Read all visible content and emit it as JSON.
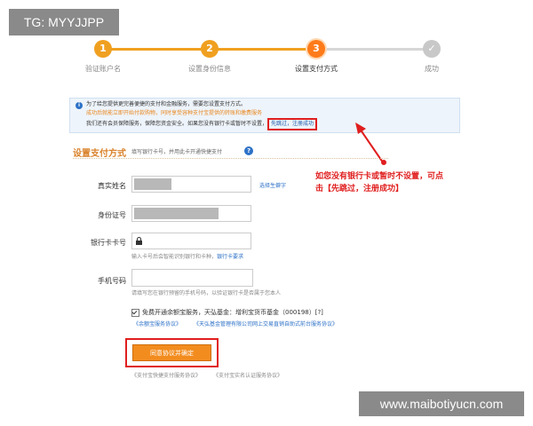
{
  "watermarks": {
    "top_left": "TG: MYYJJPP",
    "bottom_right": "www.maibotiyucn.com"
  },
  "steps": [
    {
      "number": "1",
      "label": "验证账户名",
      "state": "done"
    },
    {
      "number": "2",
      "label": "设置身份信息",
      "state": "done"
    },
    {
      "number": "3",
      "label": "设置支付方式",
      "state": "current"
    },
    {
      "number": "✓",
      "label": "成功",
      "state": "todo"
    }
  ],
  "notice": {
    "line1": "为了给您提供更完善便捷的支付和金融服务，需要您设置支付方式。",
    "line2": "成功后就能立即开始付款购物，同时享受容种支付宝提供的转账和缴费服务",
    "line3": "我们还有会员保障服务，保障您资金安全。如果您没有银行卡或暂时不设置，",
    "skip_link": "先跳过，注册成功"
  },
  "section": {
    "title": "设置支付方式",
    "hint": "填写银行卡号，并用此卡开通快捷支付"
  },
  "form": {
    "name_label": "真实姓名",
    "name_link": "选择生僻字",
    "id_label": "身份证号",
    "card_label": "银行卡卡号",
    "card_hint": "输入卡号后会智能识别银行和卡种，",
    "card_link": "银行卡要求",
    "phone_label": "手机号码",
    "phone_hint": "请填写您在银行预留的手机号码，以验证银行卡是否属于您本人"
  },
  "agreement": {
    "text": "免费开通余额宝服务，天弘基金：增利宝货币基金（000198）[?]",
    "link1": "《余额宝服务协议》",
    "link2": "《天弘基金管理有限公司网上交易直销自助式前台服务协议》"
  },
  "submit": {
    "label": "同意协议并确定"
  },
  "footer_links": {
    "link1": "《支付宝快捷支付服务协议》",
    "link2": "《支付宝实名认证服务协议》"
  },
  "annotation": {
    "line1": "如您没有银行卡或暂时不设置，可点",
    "line2": "击【先跳过，注册成功】"
  },
  "colors": {
    "accent_orange": "#f0a020",
    "button_orange": "#f28c1f",
    "annotation_red": "#e01e1e",
    "link_blue": "#2c71c7"
  }
}
